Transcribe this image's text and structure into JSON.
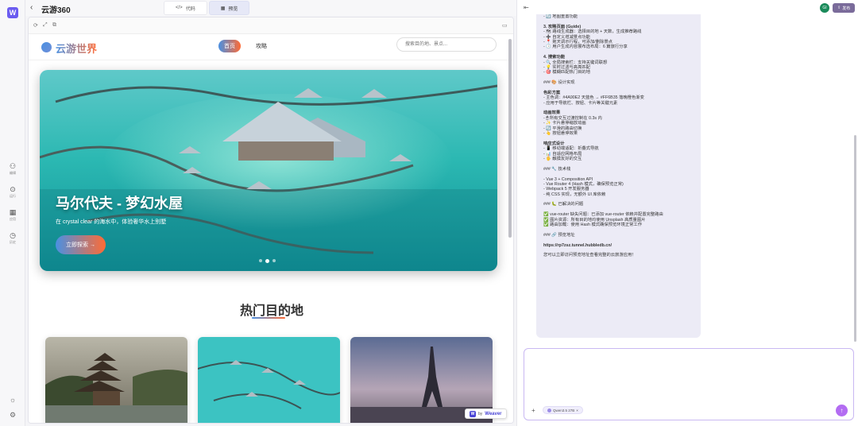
{
  "app": {
    "title": "云游360",
    "back_icon": "chevron-left-icon"
  },
  "tabs": [
    {
      "label": "代码",
      "icon": "</>"
    },
    {
      "label": "预览",
      "icon": "▦"
    }
  ],
  "rail": {
    "logo": "W",
    "items": [
      {
        "icon": "workflow-icon",
        "label": "编辑"
      },
      {
        "icon": "play-icon",
        "label": "运行"
      },
      {
        "icon": "apps-icon",
        "label": "应用"
      },
      {
        "icon": "history-icon",
        "label": "历史"
      }
    ]
  },
  "site": {
    "brand": "云游世界",
    "nav_home": "首页",
    "nav_guide": "攻略",
    "search_placeholder": "搜索目的地、景点...",
    "hero_title": "马尔代夫 - 梦幻水屋",
    "hero_subtitle": "在 crystal clear 的海水中，体验奢华水上别墅",
    "hero_button": "立即探索 →",
    "section_title": "热门目的地"
  },
  "weaver": {
    "prefix": "by",
    "name": "Weaver"
  },
  "right": {
    "avatar": "GI",
    "publish": "发布"
  },
  "chat_lines": [
    {
      "t": "- 🔄 地图重置功能",
      "s": ""
    },
    {
      "t": "",
      "s": "sp"
    },
    {
      "t": "3. 攻略页面 (Guide)",
      "s": "b"
    },
    {
      "t": "- 🗺 路线生成器：选择目的地 + 天数，生成推荐路线",
      "s": ""
    },
    {
      "t": "- ➕ 自定义增减景点功能",
      "s": ""
    },
    {
      "t": "- 📍 拖天调示行程，可添加/删除景点",
      "s": ""
    },
    {
      "t": "- 🕓 用户生成内容展布选布局：6 篇旅行分享",
      "s": ""
    },
    {
      "t": "",
      "s": "sp"
    },
    {
      "t": "4. 搜索功能",
      "s": "b"
    },
    {
      "t": "- 🔍 全局搜索栏：支持关键词联想",
      "s": ""
    },
    {
      "t": "- 💡 实时过滤与高亮匹配",
      "s": ""
    },
    {
      "t": "- 🎯 模糊匹配热门目的地",
      "s": ""
    },
    {
      "t": "",
      "s": "sp"
    },
    {
      "t": "### 🎨 设计实现",
      "s": ""
    },
    {
      "t": "",
      "s": "sp"
    },
    {
      "t": "色彩方案",
      "s": "b"
    },
    {
      "t": "- 主色调：#4A90E2 天蓝色 → #FF6B35 落晚橙色渐变",
      "s": ""
    },
    {
      "t": "- 应用于导航栏、按钮、卡片等关键元素",
      "s": ""
    },
    {
      "t": "",
      "s": "sp"
    },
    {
      "t": "动画效果",
      "s": "b"
    },
    {
      "t": "- 🖱 所有交互过渡控制在 0.3s 内",
      "s": ""
    },
    {
      "t": "- ✨ 卡片悬停缩放动画",
      "s": ""
    },
    {
      "t": "- 🔄 平滑的路由切换",
      "s": ""
    },
    {
      "t": "- 👆 按钮悬停效果",
      "s": ""
    },
    {
      "t": "",
      "s": "sp"
    },
    {
      "t": "响应式设计",
      "s": "b"
    },
    {
      "t": "- 📱 移动端适配：折叠式导航",
      "s": ""
    },
    {
      "t": "- 📊 自适应网格布局",
      "s": ""
    },
    {
      "t": "- 🖐 触摸友好的交互",
      "s": ""
    },
    {
      "t": "",
      "s": "sp"
    },
    {
      "t": "### 🔧 技术栈",
      "s": ""
    },
    {
      "t": "",
      "s": "sp"
    },
    {
      "t": "- Vue 3 + Composition API",
      "s": ""
    },
    {
      "t": "- Vue Router 4 (Hash 模式，确保预览正常)",
      "s": ""
    },
    {
      "t": "- Webpack 5 开发服务器",
      "s": ""
    },
    {
      "t": "- 纯 CSS 实现，无额外 UI 库依赖",
      "s": ""
    },
    {
      "t": "",
      "s": "sp"
    },
    {
      "t": "### 🐛 已解决的问题",
      "s": ""
    },
    {
      "t": "",
      "s": "sp"
    },
    {
      "t": "✅ vue-router 缺失问题：已添加 vue-router 依赖并配置完整路由",
      "s": ""
    },
    {
      "t": "✅ 图片资源：所有目的地均使用 Unsplash 高质量图片",
      "s": ""
    },
    {
      "t": "✅ 路由加载：使用 Hash 模式确保预览环境正常工作",
      "s": ""
    },
    {
      "t": "",
      "s": "sp"
    },
    {
      "t": "### 🔗 预览地址",
      "s": ""
    },
    {
      "t": "",
      "s": "sp"
    },
    {
      "t": "https://rp7zsz.tunnel.hubbledb.cn/",
      "s": "b"
    },
    {
      "t": "",
      "s": "sp"
    },
    {
      "t": "您可以立即访问预览地址查看完整的云旅游应用！",
      "s": ""
    }
  ],
  "input": {
    "model": "Qwen3.5 27B",
    "send_icon": "arrow-up-icon",
    "add_icon": "plus-icon"
  },
  "colors": {
    "primary": "#4A90E2",
    "accent": "#FF6B35",
    "app_accent": "#6b5cf0"
  }
}
